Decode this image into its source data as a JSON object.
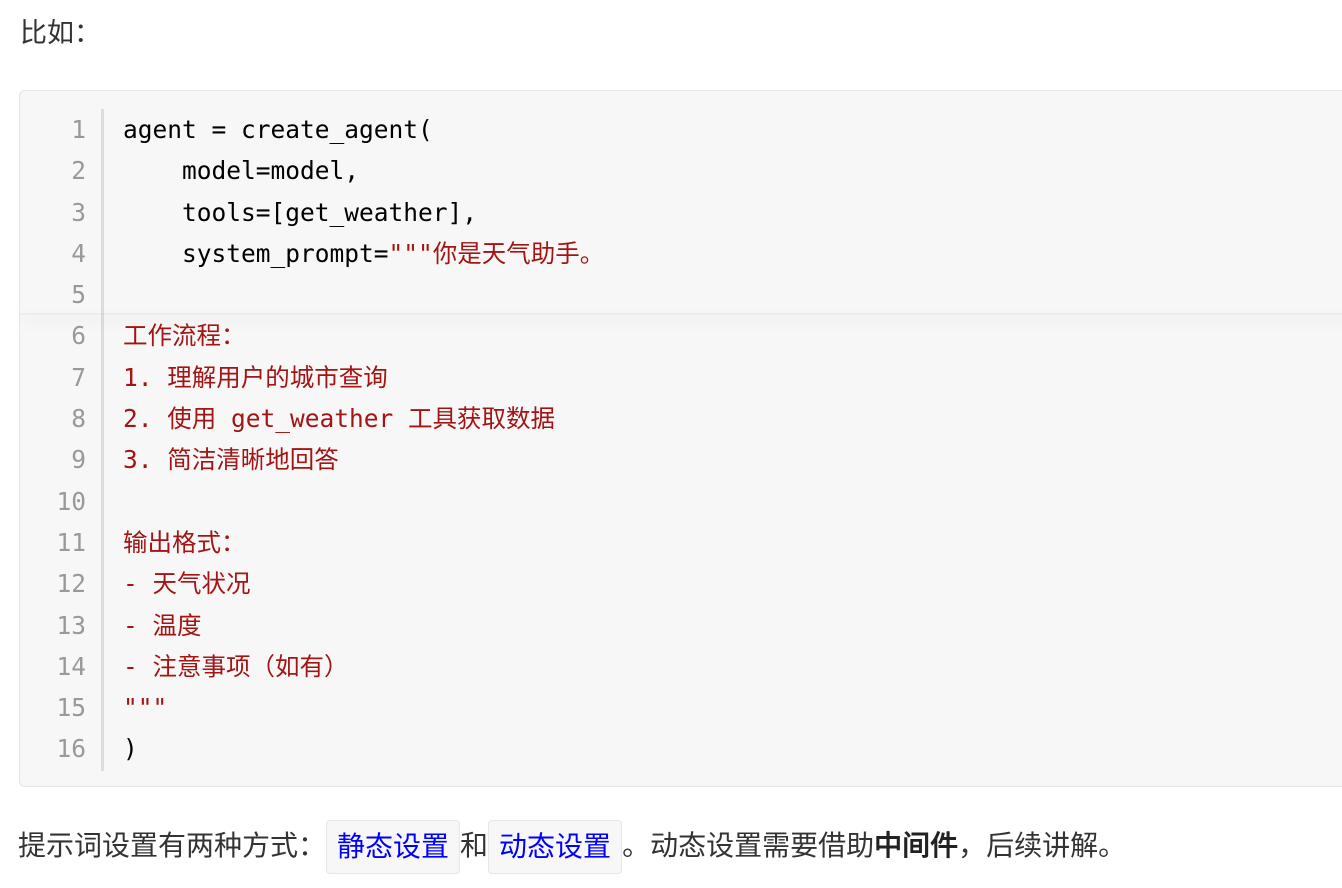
{
  "intro": "比如：",
  "code": {
    "lines": [
      {
        "n": "1",
        "plain": "agent = create_agent(",
        "str": ""
      },
      {
        "n": "2",
        "plain": "    model=model,",
        "str": ""
      },
      {
        "n": "3",
        "plain": "    tools=[get_weather],",
        "str": ""
      },
      {
        "n": "4",
        "plain": "    system_prompt=",
        "str": "\"\"\"你是天气助手。"
      },
      {
        "n": "5",
        "plain": "",
        "str": ""
      },
      {
        "n": "6",
        "plain": "",
        "str": "工作流程："
      },
      {
        "n": "7",
        "plain": "",
        "str": "1. 理解用户的城市查询"
      },
      {
        "n": "8",
        "plain": "",
        "str": "2. 使用 get_weather 工具获取数据"
      },
      {
        "n": "9",
        "plain": "",
        "str": "3. 简洁清晰地回答"
      },
      {
        "n": "10",
        "plain": "",
        "str": ""
      },
      {
        "n": "11",
        "plain": "",
        "str": "输出格式："
      },
      {
        "n": "12",
        "plain": "",
        "str": "- 天气状况"
      },
      {
        "n": "13",
        "plain": "",
        "str": "- 温度"
      },
      {
        "n": "14",
        "plain": "",
        "str": "- 注意事项（如有）"
      },
      {
        "n": "15",
        "plain": "",
        "str": "\"\"\""
      },
      {
        "n": "16",
        "plain": ")",
        "str": ""
      }
    ]
  },
  "para": {
    "prefix": "提示词设置有两种方式：",
    "link1": "静态设置",
    "and": "和",
    "link2": "动态设置",
    "middle": "。动态设置需要借助",
    "bold": "中间件",
    "suffix": "，后续讲解。"
  },
  "colors": {
    "string": "#a31515",
    "link": "#0000ff",
    "line_number": "#999999"
  }
}
